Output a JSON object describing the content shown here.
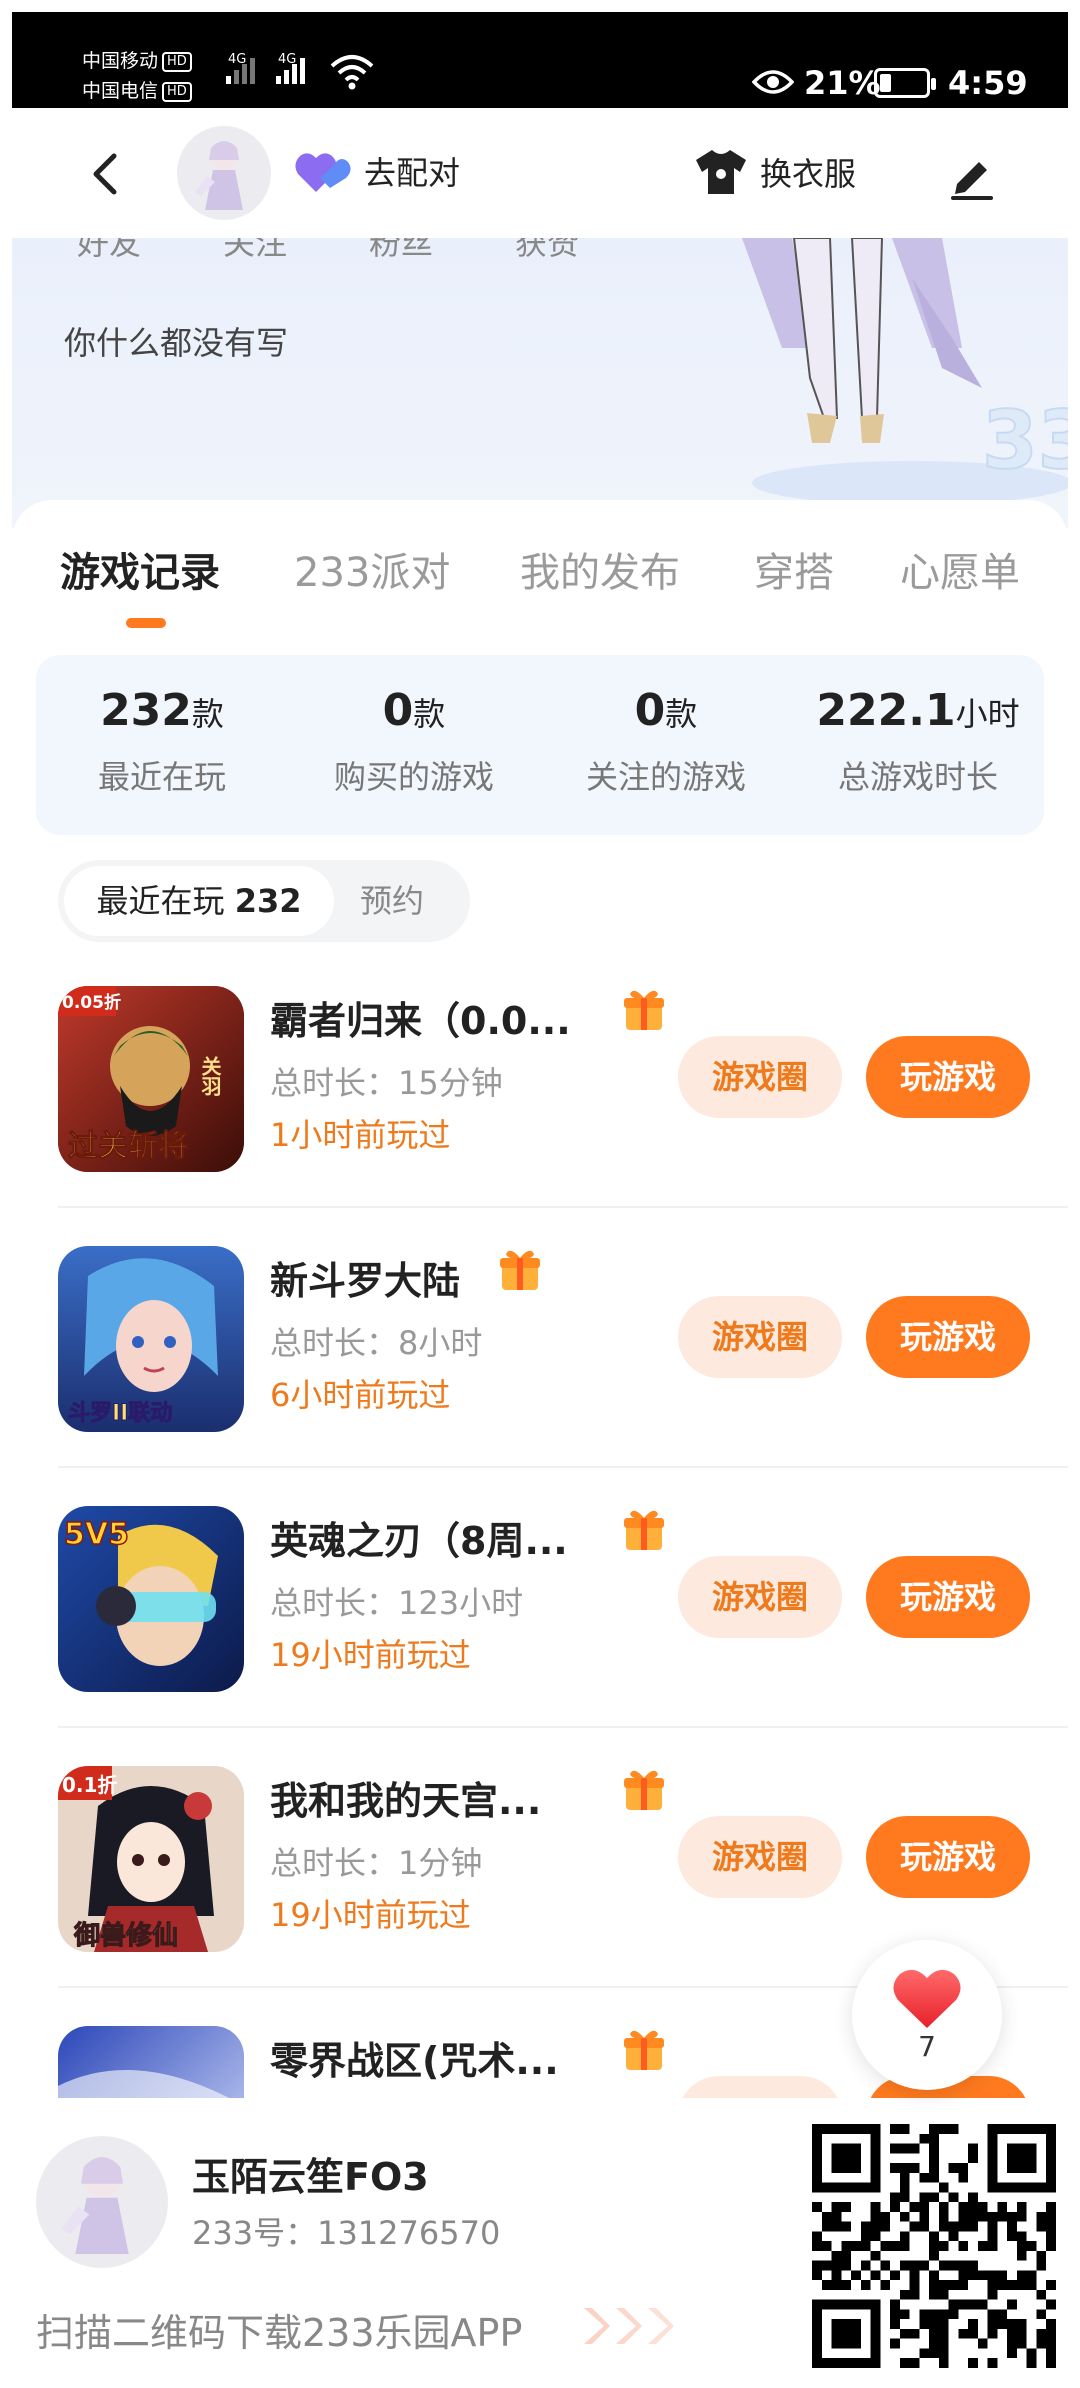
{
  "status_bar": {
    "carrier1": "中国移动",
    "carrier2": "中国电信",
    "hd": "HD",
    "net_type": "4G",
    "battery_percent": "21%",
    "battery_level": 0.21,
    "time": "4:59"
  },
  "header": {
    "match_label": "去配对",
    "outfit_label": "换衣服"
  },
  "profile": {
    "stats": [
      "好友",
      "关注",
      "粉丝",
      "获赞"
    ],
    "bio": "你什么都没有写"
  },
  "tabs": [
    "游戏记录",
    "233派对",
    "我的发布",
    "穿搭",
    "心愿单"
  ],
  "summary": [
    {
      "num": "232",
      "unit": "款",
      "label": "最近在玩"
    },
    {
      "num": "0",
      "unit": "款",
      "label": "购买的游戏"
    },
    {
      "num": "0",
      "unit": "款",
      "label": "关注的游戏"
    },
    {
      "num": "222.1",
      "unit": "小时",
      "label": "总游戏时长"
    }
  ],
  "segment": {
    "active_label": "最近在玩",
    "active_count": "232",
    "inactive_label": "预约"
  },
  "games": [
    {
      "title": "霸者归来（0.0...",
      "duration": "总时长：15分钟",
      "last_played": "1小时前玩过"
    },
    {
      "title": "新斗罗大陆",
      "duration": "总时长：8小时",
      "last_played": "6小时前玩过"
    },
    {
      "title": "英魂之刃（8周...",
      "duration": "总时长：123小时",
      "last_played": "19小时前玩过"
    },
    {
      "title": "我和我的天宫...",
      "duration": "总时长：1分钟",
      "last_played": "19小时前玩过"
    },
    {
      "title": "零界战区(咒术...",
      "duration": "",
      "last_played": ""
    }
  ],
  "game_buttons": {
    "circle": "游戏圈",
    "play": "玩游戏"
  },
  "icon_texts": [
    {
      "badge": "0.05折",
      "side": "关羽",
      "bottom": "过关斩将"
    },
    {
      "bottom": "斗罗II联动"
    },
    {
      "badge": "5V5"
    },
    {
      "badge": "0.1折",
      "bottom": "御兽修仙"
    },
    {}
  ],
  "fab": {
    "count": "7"
  },
  "footer": {
    "name": "玉陌云笙FO3",
    "id_text": "233号：131276570",
    "scan_text": "扫描二维码下载233乐园APP"
  },
  "colors": {
    "accent": "#ff7a1e",
    "accent_light": "#fde9de"
  }
}
